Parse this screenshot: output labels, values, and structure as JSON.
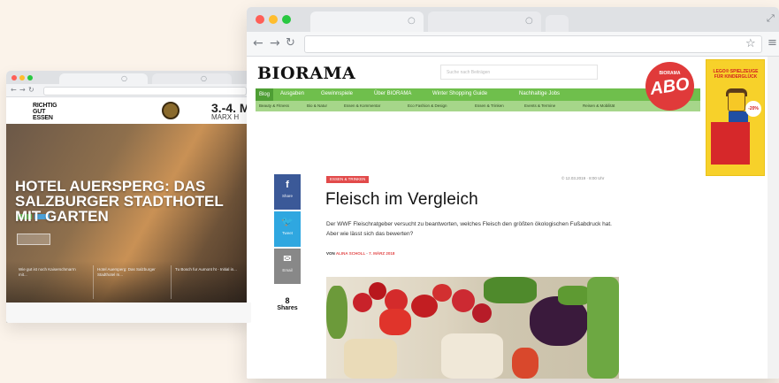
{
  "left_window": {
    "site_logo": [
      "RICHTIG",
      "GUT",
      "ESSEN"
    ],
    "header_date": "3.-4. M",
    "header_sub": "MARX H",
    "hero_title": "HOTEL AUERSPERG: DAS SALZBURGER STADTHOTEL MIT GARTEN",
    "cards": [
      "Wie gut ist noch Kaiserschmarrn mit...",
      "Hotel Auersperg: Das Salzburger Stadthotel m...",
      "Tu Bosch fur Aumont ht - Initial in..."
    ]
  },
  "right_window": {
    "icons": {
      "back": "back-arrow-icon",
      "forward": "forward-arrow-icon",
      "reload": "reload-icon",
      "star": "bookmark-star-icon",
      "menu": "menu-icon",
      "expand": "expand-icon"
    },
    "site": {
      "logo": "BIORAMA",
      "search_placeholder": "Suche nach Beiträgen",
      "abo_badge": {
        "small": "BIORAMA",
        "big": "ABO"
      },
      "nav": [
        "Blog",
        "Ausgaben",
        "Gewinnspiele",
        "Über BIORAMA",
        "Winter Shopping Guide",
        "Nachhaltige Jobs"
      ],
      "subnav": [
        "Beauty & Fitness",
        "Bio & Natur",
        "Essen & Kommentar",
        "Eco Fashion & Design",
        "Essen & Trinken",
        "Events & Termine",
        "Reisen & Mobilität"
      ],
      "ad": {
        "headline": "LEGO® SPIELZEUGE FÜR KINDERGLÜCK",
        "badge": "-20%"
      },
      "share": {
        "facebook": "Share",
        "twitter": "Tweet",
        "email": "Email",
        "count": "8",
        "count_label": "Shares"
      },
      "article": {
        "category": "ESSEN & TRINKEN",
        "date_top": "© 12.03.2019 · 8:00 Uhr",
        "title": "Fleisch im Vergleich",
        "lead": "Der WWF Fleischratgeber versucht zu beantworten, welches Fleisch den größten ökologischen Fußabdruck hat. Aber wie lässt sich das bewerten?",
        "byline_prefix": "VON",
        "author": "ALINA SCHOLL",
        "byline_sep": "·",
        "date": "7. MÄRZ 2018"
      }
    }
  },
  "colors": {
    "page_bg": "#fbf3ea",
    "biorama_green": "#6fbf4c",
    "abo_red": "#e03a3a",
    "facebook": "#3b5998",
    "twitter": "#2fa7e0",
    "email": "#888888"
  }
}
